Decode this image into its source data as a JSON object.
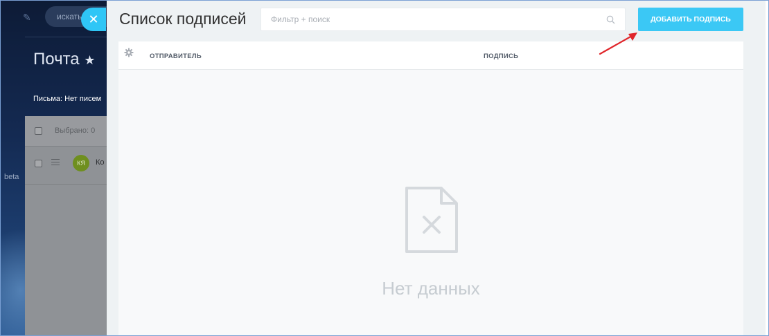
{
  "background": {
    "search_text": "искать",
    "title": "Почта",
    "star": "★",
    "letters_label": "Письма: Нет писем",
    "selected_label": "Выбрано: 0",
    "avatar_initials": "КЯ",
    "contact_name": "Ко",
    "beta_label": "beta"
  },
  "slider": {
    "close_glyph": "✕",
    "title": "Список подписей",
    "filter_placeholder": "Фильтр + поиск",
    "add_button_label": "ДОБАВИТЬ ПОДПИСЬ",
    "columns": [
      "ОТПРАВИТЕЛЬ",
      "ПОДПИСЬ"
    ],
    "empty_text": "Нет данных"
  },
  "colors": {
    "accent": "#3bc8f5",
    "annotation_arrow": "#e0262b"
  },
  "icons": [
    "pencil-icon",
    "star-icon",
    "close-icon",
    "search-icon",
    "gear-icon",
    "empty-document-icon",
    "menu-icon"
  ]
}
